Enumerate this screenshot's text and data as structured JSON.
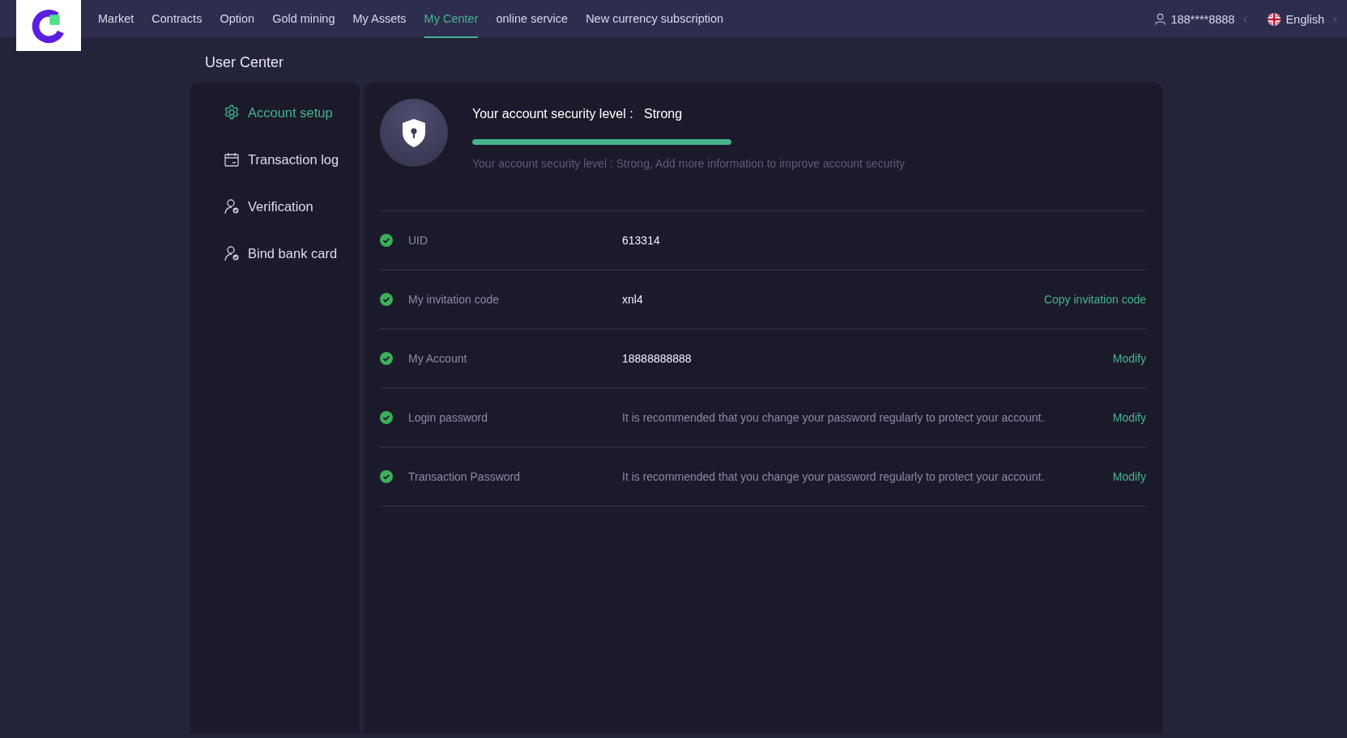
{
  "nav": {
    "items": [
      {
        "label": "Market",
        "selected": false
      },
      {
        "label": "Contracts",
        "selected": false
      },
      {
        "label": "Option",
        "selected": false
      },
      {
        "label": "Gold mining",
        "selected": false
      },
      {
        "label": "My Assets",
        "selected": false
      },
      {
        "label": "My Center",
        "selected": true
      },
      {
        "label": "online service",
        "selected": false
      },
      {
        "label": "New currency subscription",
        "selected": false
      }
    ],
    "user": "188****8888",
    "language": "English"
  },
  "page_title": "User Center",
  "sidebar": {
    "items": [
      {
        "label": "Account setup",
        "kind": "gear",
        "selected": true
      },
      {
        "label": "Transaction log",
        "kind": "calendar",
        "selected": false
      },
      {
        "label": "Verification",
        "kind": "person",
        "selected": false
      },
      {
        "label": "Bind bank card",
        "kind": "person",
        "selected": false
      }
    ]
  },
  "security": {
    "title": "Your account security level :",
    "value": "Strong",
    "level": 1,
    "hint": "Your account security level : Strong,  Add more information to improve account security"
  },
  "rows": [
    {
      "label": "UID",
      "value": "613314",
      "kind": "value",
      "verified": true
    },
    {
      "label": "My invitation code",
      "value": "xnl4",
      "kind": "value",
      "verified": true,
      "action": "Copy invitation code"
    },
    {
      "label": "My Account",
      "value": "18888888888",
      "kind": "value",
      "verified": true,
      "action": "Modify"
    },
    {
      "label": "Login password",
      "value": "It is recommended that you change your password regularly to protect your account.",
      "kind": "hint",
      "verified": true,
      "action": "Modify"
    },
    {
      "label": "Transaction Password",
      "value": "It is recommended that you change your password regularly to protect your account.",
      "kind": "hint",
      "verified": true,
      "action": "Modify"
    }
  ]
}
